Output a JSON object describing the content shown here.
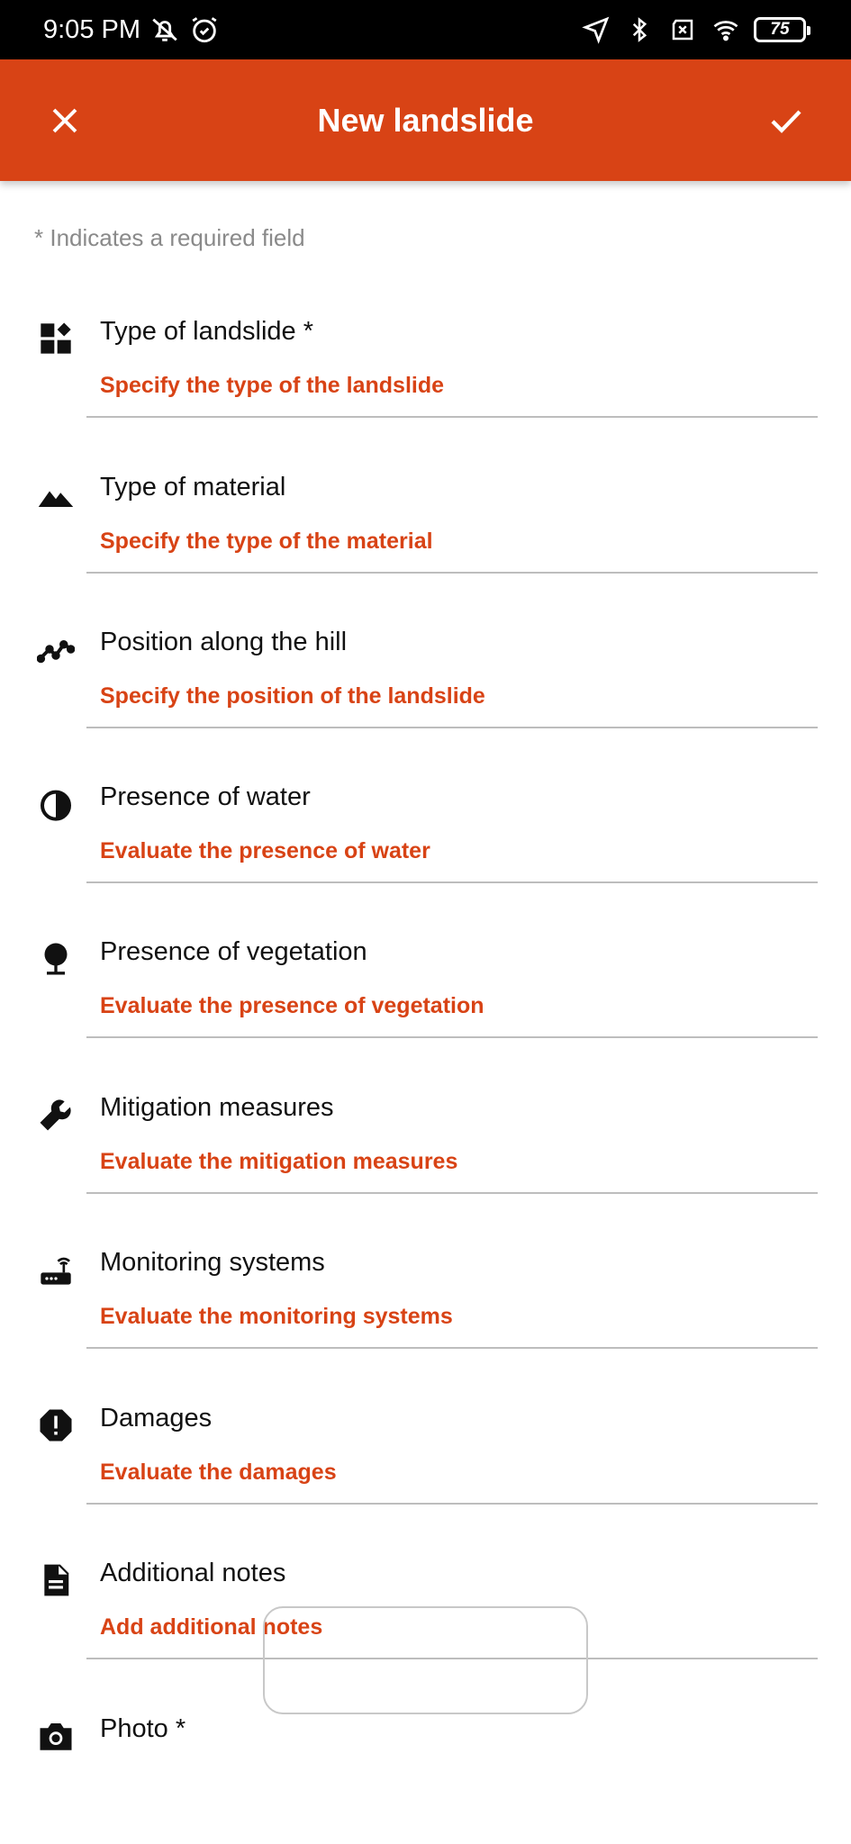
{
  "status_bar": {
    "time": "9:05 PM",
    "battery": "75",
    "icons": [
      "mute-icon",
      "alarm-icon",
      "location-icon",
      "bluetooth-icon",
      "sim-off-icon",
      "wifi-icon",
      "battery-icon"
    ]
  },
  "app_bar": {
    "title": "New landslide",
    "close_icon": "close-icon",
    "confirm_icon": "check-icon",
    "color": "#d84315"
  },
  "form": {
    "required_hint": "* Indicates a required field",
    "accent_color": "#d84315",
    "fields": [
      {
        "label": "Type of landslide *",
        "placeholder": "Specify the type of the landslide",
        "icon": "widgets-icon"
      },
      {
        "label": "Type of material",
        "placeholder": "Specify the type of the material",
        "icon": "terrain-icon"
      },
      {
        "label": "Position along the hill",
        "placeholder": "Specify the position of the landslide",
        "icon": "trend-line-icon"
      },
      {
        "label": "Presence of water",
        "placeholder": "Evaluate the presence of water",
        "icon": "water-drop-icon"
      },
      {
        "label": "Presence of vegetation",
        "placeholder": "Evaluate the presence of vegetation",
        "icon": "tree-icon"
      },
      {
        "label": "Mitigation measures",
        "placeholder": "Evaluate the mitigation measures",
        "icon": "wrench-icon"
      },
      {
        "label": "Monitoring systems",
        "placeholder": "Evaluate the monitoring systems",
        "icon": "router-icon"
      },
      {
        "label": "Damages",
        "placeholder": "Evaluate the damages",
        "icon": "report-icon"
      },
      {
        "label": "Additional notes",
        "placeholder": "Add additional notes",
        "icon": "document-icon"
      }
    ],
    "photo": {
      "label": "Photo *",
      "icon": "camera-icon"
    }
  }
}
